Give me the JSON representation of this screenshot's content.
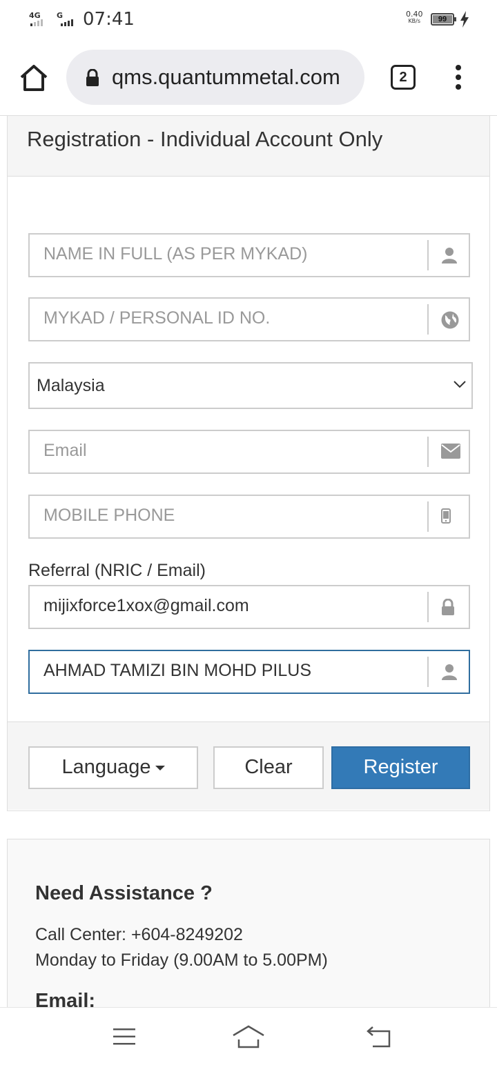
{
  "status_bar": {
    "signal1_label": "4G",
    "signal2_label": "G",
    "time": "07:41",
    "net_speed": "0.40",
    "net_speed_unit": "KB/s",
    "battery": "99"
  },
  "browser": {
    "url": "qms.quantummetal.com",
    "tab_count": "2"
  },
  "form": {
    "title": "Registration - Individual Account Only",
    "name_placeholder": "NAME IN FULL (AS PER MYKAD)",
    "id_placeholder": "MYKAD / PERSONAL ID NO.",
    "country_value": "Malaysia",
    "email_placeholder": "Email",
    "phone_placeholder": "MOBILE PHONE",
    "referral_label": "Referral (NRIC / Email)",
    "referral_value": "mijixforce1xox@gmail.com",
    "referrer_name_value": "AHMAD TAMIZI BIN MOHD PILUS",
    "language_button": "Language",
    "clear_button": "Clear",
    "register_button": "Register"
  },
  "assistance": {
    "title": "Need Assistance ?",
    "call_center": "Call Center: +604-8249202",
    "hours": "Monday to Friday (9.00AM to 5.00PM)",
    "email_heading": "Email:"
  },
  "colors": {
    "primary": "#337ab7",
    "focus_border": "#2f6d9e",
    "border": "#cccccc",
    "muted_text": "#999999"
  }
}
